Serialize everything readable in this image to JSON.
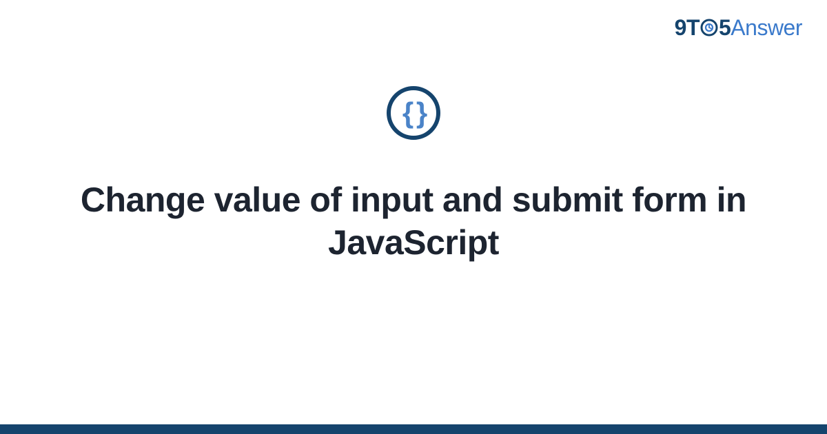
{
  "brand": {
    "nine": "9",
    "t": "T",
    "five": "5",
    "answer": "Answer"
  },
  "badge": {
    "braces": "{ }",
    "icon_name": "code-braces-icon"
  },
  "title": "Change value of input and submit form in JavaScript",
  "colors": {
    "dark_blue": "#15446d",
    "light_blue": "#3b7acb",
    "brace_blue": "#4a83c8",
    "text": "#1d2430"
  }
}
